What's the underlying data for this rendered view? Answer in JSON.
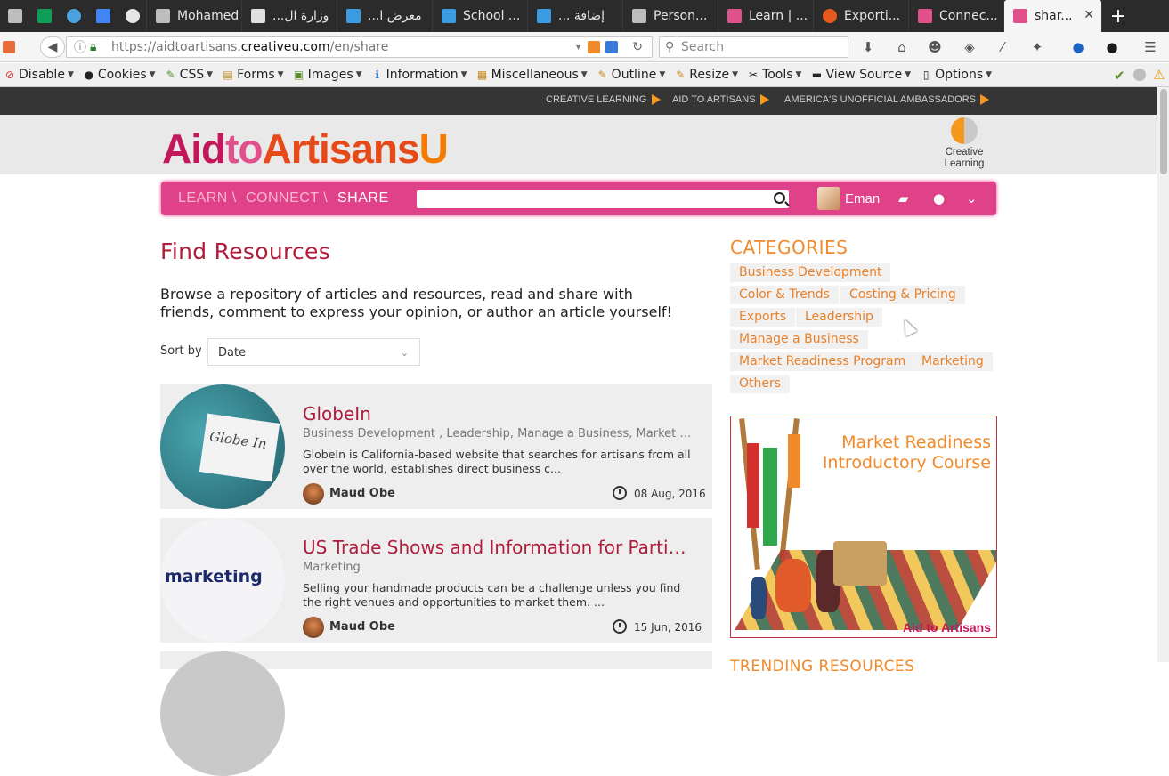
{
  "browser": {
    "tabs": [
      {
        "label": "",
        "icon": "gmail-icon",
        "color": "#c0c0c0",
        "pinned": true
      },
      {
        "label": "",
        "icon": "sheets-icon",
        "color": "#0f9d58",
        "pinned": true
      },
      {
        "label": "",
        "icon": "asterisk-icon",
        "color": "#4aa3df",
        "pinned": true
      },
      {
        "label": "",
        "icon": "docs-icon",
        "color": "#4285f4",
        "pinned": true
      },
      {
        "label": "",
        "icon": "olx-icon",
        "color": "#e6e6e6",
        "pinned": true
      },
      {
        "label": "Mohamed ...",
        "icon": "gmail-icon",
        "color": "#c0c0c0"
      },
      {
        "label": "...وزارة ال",
        "icon": "doc-icon",
        "color": "#e0e0e0"
      },
      {
        "label": "...معرض ا",
        "icon": "circle-app-icon",
        "color": "#3b9be0"
      },
      {
        "label": "School ...",
        "icon": "circle-app-icon",
        "color": "#3b9be0"
      },
      {
        "label": "... إضافة",
        "icon": "circle-app-icon",
        "color": "#3b9be0"
      },
      {
        "label": "Person...",
        "icon": "gmail-icon",
        "color": "#c0c0c0"
      },
      {
        "label": "Learn | ...",
        "icon": "aid-icon",
        "color": "#e0508a"
      },
      {
        "label": "Exporti...",
        "icon": "spinner-icon",
        "color": "#e65a1e"
      },
      {
        "label": "Connec...",
        "icon": "aid-icon",
        "color": "#e0508a"
      },
      {
        "label": "shar...",
        "icon": "aid-icon",
        "color": "#e0508a",
        "active": true
      }
    ],
    "new_tab": "+",
    "url_prefix": "https://aidtoartisans.",
    "url_domain": "creativeu.com",
    "url_path": "/en/share",
    "search_placeholder": "Search",
    "close_glyph": "✕"
  },
  "devbar": {
    "items": [
      {
        "label": "Disable",
        "icon": "disable-icon",
        "glyph": "⊘",
        "color": "#d32f2f"
      },
      {
        "label": "Cookies",
        "icon": "cookies-icon",
        "glyph": "●",
        "color": "#333"
      },
      {
        "label": "CSS",
        "icon": "css-icon",
        "glyph": "✎",
        "color": "#5a8f29"
      },
      {
        "label": "Forms",
        "icon": "forms-icon",
        "glyph": "▤",
        "color": "#c58a1b"
      },
      {
        "label": "Images",
        "icon": "images-icon",
        "glyph": "▣",
        "color": "#5a8f29"
      },
      {
        "label": "Information",
        "icon": "information-icon",
        "glyph": "ℹ",
        "color": "#1f64c0"
      },
      {
        "label": "Miscellaneous",
        "icon": "miscellaneous-icon",
        "glyph": "▦",
        "color": "#c58a1b"
      },
      {
        "label": "Outline",
        "icon": "outline-icon",
        "glyph": "✎",
        "color": "#c58a1b"
      },
      {
        "label": "Resize",
        "icon": "resize-icon",
        "glyph": "✎",
        "color": "#c58a1b"
      },
      {
        "label": "Tools",
        "icon": "tools-icon",
        "glyph": "✂",
        "color": "#333"
      },
      {
        "label": "View Source",
        "icon": "view-source-icon",
        "glyph": "▬",
        "color": "#333"
      },
      {
        "label": "Options",
        "icon": "options-icon",
        "glyph": "▯",
        "color": "#555"
      }
    ]
  },
  "site": {
    "top_links": [
      "CREATIVE LEARNING",
      "AID TO ARTISANS",
      "AMERICA'S UNOFFICIAL AMBASSADORS"
    ],
    "logo_parts": [
      "Aid",
      "to",
      "Artisans",
      "U"
    ],
    "partner_logo_lines": [
      "Creative",
      "Learning"
    ],
    "nav": {
      "learn": "LEARN \\",
      "connect": "CONNECT \\",
      "share": "SHARE"
    },
    "search_value": "",
    "user_name": "Eman"
  },
  "main": {
    "title": "Find Resources",
    "intro": "Browse a repository of articles and resources, read and share with friends, comment to express your opinion, or author an article yourself!",
    "sort_label": "Sort by",
    "sort_value": "Date",
    "articles": [
      {
        "title": "GlobeIn",
        "categories": "Business Development , Leadership, Manage a Business, Market Readine...",
        "description": "GlobeIn is California-based website that searches for artisans from all over the world, establishes direct business c...",
        "author": "Maud Obe",
        "date": "08 Aug, 2016",
        "thumb_text": "Globe In"
      },
      {
        "title": "US Trade Shows and Information for Partici...",
        "categories": "Marketing",
        "description": "Selling your handmade products can be a challenge unless you find the right venues and opportunities to market them. ...",
        "author": "Maud Obe",
        "date": "15 Jun, 2016",
        "thumb_text": "marketing"
      }
    ]
  },
  "sidebar": {
    "categories_title": "CATEGORIES",
    "categories": [
      "Business Development",
      "Color & Trends",
      "Costing & Pricing",
      "Exports",
      "Leadership",
      "Manage a Business",
      "Market Readiness Program",
      "Marketing",
      "Others"
    ],
    "ad_line1": "Market Readiness",
    "ad_line2": "Introductory Course",
    "ad_brand": "Aid to Artisans",
    "trending_title": "TRENDING RESOURCES"
  }
}
